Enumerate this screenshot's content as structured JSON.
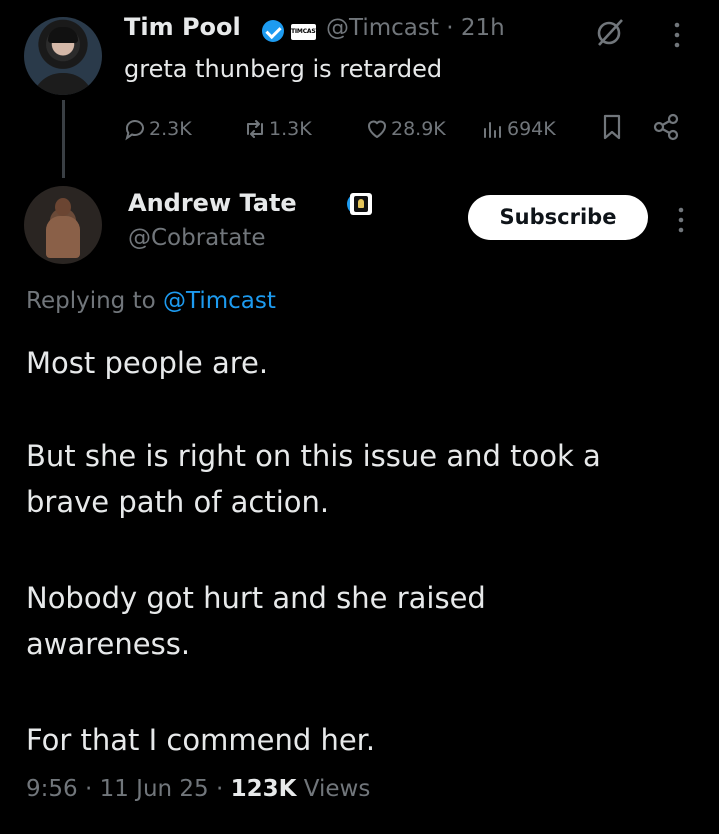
{
  "parent_tweet": {
    "author_name": "Tim Pool",
    "affiliate_badge_text": "TIMCAST",
    "handle": "@Timcast",
    "separator": "·",
    "time": "21h",
    "text": "greta thunberg is retarded",
    "stats": {
      "replies": "2.3K",
      "reposts": "1.3K",
      "likes": "28.9K",
      "views": "694K"
    },
    "icons": {
      "reply": "reply-icon",
      "repost": "repost-icon",
      "like": "heart-icon",
      "views": "views-icon",
      "bookmark": "bookmark-icon",
      "share": "share-icon",
      "grok": "grok-icon",
      "more": "more-vertical-icon"
    }
  },
  "reply_tweet": {
    "author_name": "Andrew Tate",
    "handle": "@Cobratate",
    "subscribe_label": "Subscribe",
    "replying_prefix": "Replying to",
    "replying_to": "@Timcast",
    "paragraphs": [
      "Most people are.",
      "But she is right on this issue and took a\nbrave path of action.",
      "Nobody got hurt and she raised\nawareness.",
      "For that I commend her."
    ],
    "meta": {
      "time": "9:56",
      "date": "11 Jun 25",
      "separator": "·",
      "views_count": "123K",
      "views_label": "Views"
    }
  },
  "colors": {
    "background": "#000000",
    "text_primary": "#e7e9ea",
    "text_secondary": "#71767b",
    "accent_blue": "#1d9bf0",
    "thread_line": "#3a3f44"
  }
}
